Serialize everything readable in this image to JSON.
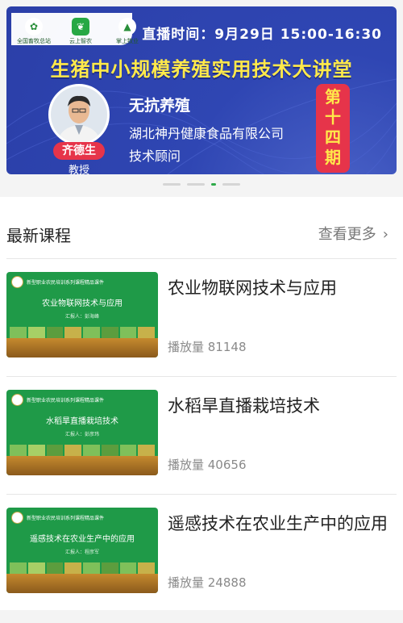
{
  "banner": {
    "logos": [
      {
        "icon": "emblem-icon",
        "caption": "全国畜牧总站"
      },
      {
        "icon": "phone-leaf-icon",
        "caption": "云上智农"
      },
      {
        "icon": "mountain-icon",
        "caption": "掌上牧业"
      }
    ],
    "live_time": "直播时间：9月29日  15:00-16:30",
    "title": "生猪中小规模养殖实用技术大讲堂",
    "speaker_name": "齐德生",
    "speaker_title": "教授",
    "topic": "无抗养殖",
    "organization": "湖北神丹健康食品有限公司",
    "role": "技术顾问",
    "episode_lines": [
      "第",
      "十",
      "四",
      "期"
    ],
    "accent_color": "#e6344a",
    "title_color": "#ffe94a",
    "background_color": "#2f46b3"
  },
  "carousel": {
    "count": 3,
    "active_index": 2
  },
  "section": {
    "title": "最新课程",
    "more_label": "查看更多",
    "more_icon": "chevron-right-icon"
  },
  "courses": [
    {
      "title": "农业物联网技术与应用",
      "plays": "播放量 81148",
      "thumb_title": "农业物联网技术与应用",
      "thumb_header": "新型职业农民培训系列课程精品课件",
      "thumb_reporter": "汇报人：彭海峰"
    },
    {
      "title": "水稻旱直播栽培技术",
      "plays": "播放量 40656",
      "thumb_title": "水稻旱直播栽培技术",
      "thumb_header": "新型职业农民培训系列课程精品课件",
      "thumb_reporter": "汇报人：彭彦玮"
    },
    {
      "title": "遥感技术在农业生产中的应用",
      "plays": "播放量 24888",
      "thumb_title": "遥感技术在农业生产中的应用",
      "thumb_header": "新型职业农民培训系列课程精品课件",
      "thumb_reporter": "汇报人：程彦军"
    }
  ]
}
